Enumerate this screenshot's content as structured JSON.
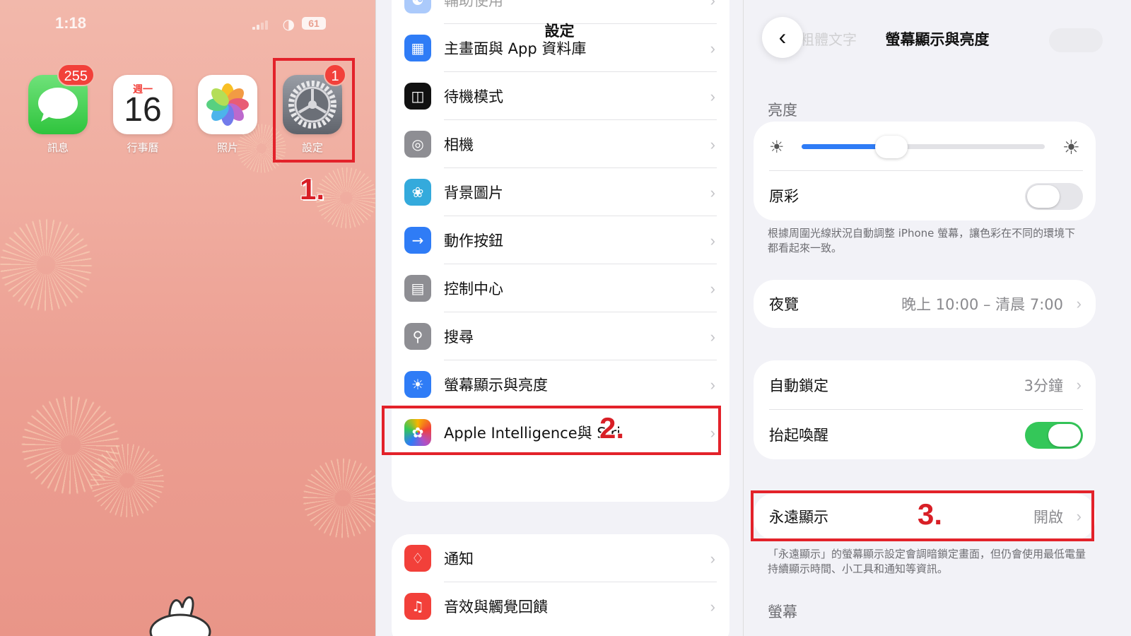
{
  "panel_home": {
    "status": {
      "time": "1:18",
      "battery": "61"
    },
    "apps": [
      {
        "label": "訊息",
        "badge": "255",
        "icon": "messages-icon"
      },
      {
        "label": "行事曆",
        "weekday": "週一",
        "day": "16",
        "icon": "calendar-icon"
      },
      {
        "label": "照片",
        "icon": "photos-icon"
      },
      {
        "label": "設定",
        "badge": "1",
        "icon": "settings-gear-icon"
      }
    ],
    "step": "1."
  },
  "panel_settings": {
    "title": "設定",
    "group1": [
      {
        "label": "輔助使用",
        "icon": "accessibility-icon",
        "color": "#2f7cf6",
        "faded": true
      },
      {
        "label": "主畫面與 App 資料庫",
        "icon": "home-screen-icon",
        "color": "#2f7cf6"
      },
      {
        "label": "待機模式",
        "icon": "standby-icon",
        "color": "#111111"
      },
      {
        "label": "相機",
        "icon": "camera-icon",
        "color": "#8e8e93"
      },
      {
        "label": "背景圖片",
        "icon": "wallpaper-icon",
        "color": "#34aadc"
      },
      {
        "label": "動作按鈕",
        "icon": "action-button-icon",
        "color": "#2f7cf6"
      },
      {
        "label": "控制中心",
        "icon": "control-center-icon",
        "color": "#8e8e93"
      },
      {
        "label": "搜尋",
        "icon": "search-icon",
        "color": "#8e8e93"
      },
      {
        "label": "螢幕顯示與亮度",
        "icon": "brightness-icon",
        "color": "#2f7cf6"
      },
      {
        "label": "Apple Intelligence與 Siri",
        "icon": "siri-icon",
        "color": "#ffffff"
      }
    ],
    "group2": [
      {
        "label": "通知",
        "icon": "notification-icon",
        "color": "#f2403a"
      },
      {
        "label": "音效與觸覺回饋",
        "icon": "sound-icon",
        "color": "#f2403a"
      }
    ],
    "step": "2."
  },
  "panel_display": {
    "back_ghost": "粗體文字",
    "title": "螢幕顯示與亮度",
    "brightness_title": "亮度",
    "brightness_level": 0.37,
    "true_tone": {
      "label": "原彩",
      "on": false
    },
    "true_tone_note": "根據周圍光線狀況自動調整 iPhone 螢幕，讓色彩在不同的環境下都看起來一致。",
    "night_shift": {
      "label": "夜覽",
      "value": "晚上 10:00 – 清晨 7:00"
    },
    "auto_lock": {
      "label": "自動鎖定",
      "value": "3分鐘"
    },
    "raise_to_wake": {
      "label": "抬起喚醒",
      "on": true
    },
    "always_on": {
      "label": "永遠顯示",
      "value": "開啟"
    },
    "always_on_note": "「永遠顯示」的螢幕顯示設定會調暗鎖定畫面，但仍會使用最低電量持續顯示時間、小工具和通知等資訊。",
    "display_title": "螢幕",
    "step": "3."
  },
  "colors": {
    "highlight": "#e3222a",
    "accent": "#2f7cf6",
    "toggle_on": "#34c759"
  }
}
